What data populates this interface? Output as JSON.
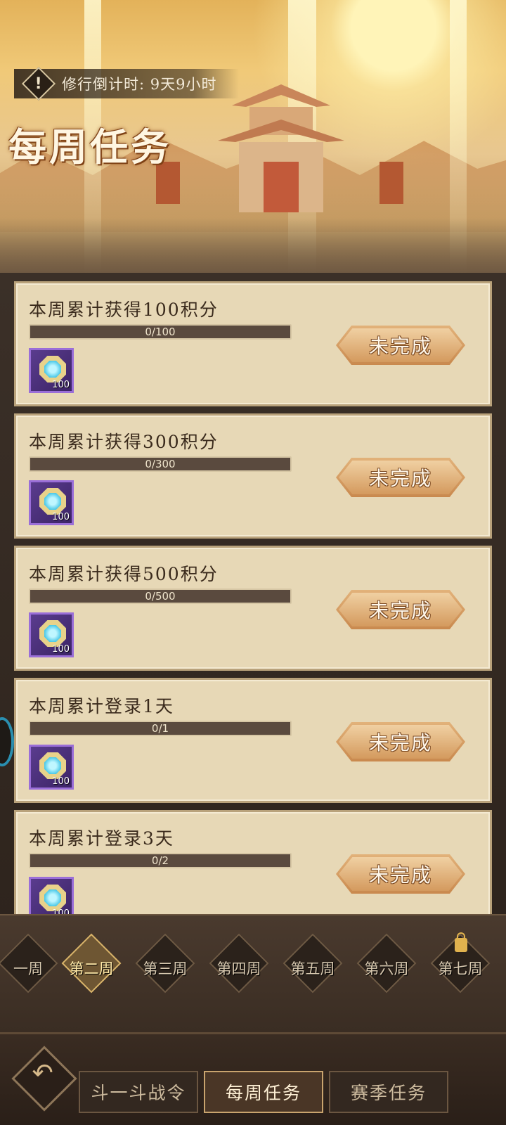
{
  "header": {
    "countdown_label": "修行倒计时: 9天9小时",
    "page_title": "每周任务"
  },
  "tasks": [
    {
      "title": "本周累计获得100积分",
      "progress_text": "0/100",
      "progress": 0,
      "reward_qty": "100",
      "status": "未完成"
    },
    {
      "title": "本周累计获得300积分",
      "progress_text": "0/300",
      "progress": 0,
      "reward_qty": "100",
      "status": "未完成"
    },
    {
      "title": "本周累计获得500积分",
      "progress_text": "0/500",
      "progress": 0,
      "reward_qty": "100",
      "status": "未完成"
    },
    {
      "title": "本周累计登录1天",
      "progress_text": "0/1",
      "progress": 0,
      "reward_qty": "100",
      "status": "未完成"
    },
    {
      "title": "本周累计登录3天",
      "progress_text": "0/2",
      "progress": 0,
      "reward_qty": "100",
      "status": "未完成"
    }
  ],
  "weeks": [
    {
      "label": "一周",
      "active": false,
      "locked": false
    },
    {
      "label": "第二周",
      "active": true,
      "locked": false
    },
    {
      "label": "第三周",
      "active": false,
      "locked": false
    },
    {
      "label": "第四周",
      "active": false,
      "locked": false
    },
    {
      "label": "第五周",
      "active": false,
      "locked": false
    },
    {
      "label": "第六周",
      "active": false,
      "locked": false
    },
    {
      "label": "第七周",
      "active": false,
      "locked": true
    }
  ],
  "bottom_nav": {
    "back_icon": "back-arrow-icon",
    "tabs": [
      {
        "label": "斗一斗战令",
        "active": false
      },
      {
        "label": "每周任务",
        "active": true
      },
      {
        "label": "赛季任务",
        "active": false
      }
    ]
  },
  "colors": {
    "progress_fill": "#e2b44a",
    "card_bg": "#e7d8b6",
    "button_text": "#fff8ec",
    "active_tab_text": "#ffe9a8"
  }
}
